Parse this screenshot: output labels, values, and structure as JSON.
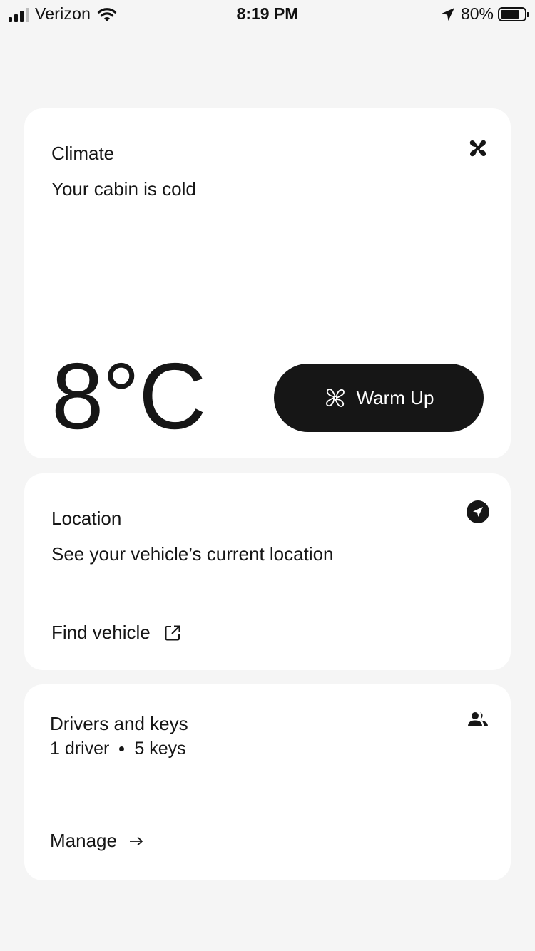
{
  "status_bar": {
    "carrier": "Verizon",
    "time": "8:19 PM",
    "battery_percent_label": "80%",
    "battery_level": 0.8
  },
  "climate": {
    "title": "Climate",
    "subtitle": "Your cabin is cold",
    "temperature": "8°C",
    "warm_up_label": "Warm Up",
    "icon": "fan-icon"
  },
  "location": {
    "title": "Location",
    "subtitle": "See your vehicle’s current location",
    "find_label": "Find vehicle",
    "icon": "navigation-icon"
  },
  "drivers": {
    "title": "Drivers and keys",
    "drivers_count": "1 driver",
    "keys_count": "5 keys",
    "manage_label": "Manage",
    "icon": "people-icon"
  },
  "colors": {
    "background": "#f5f5f5",
    "card": "#ffffff",
    "primary": "#161616"
  }
}
